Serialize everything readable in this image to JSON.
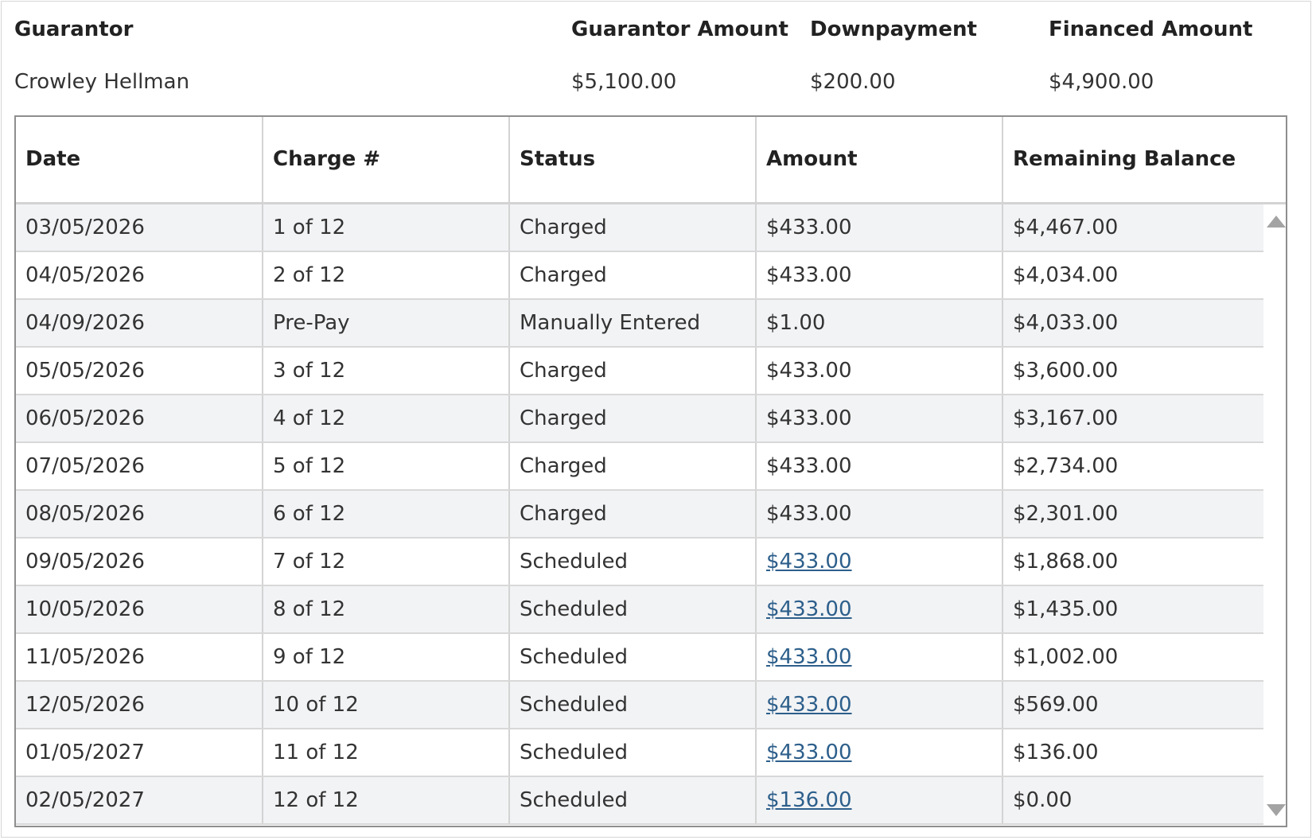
{
  "summary": {
    "headers": [
      "Guarantor",
      "Guarantor Amount",
      "Downpayment",
      "Financed Amount"
    ],
    "guarantor": "Crowley Hellman",
    "guarantor_amount": "$5,100.00",
    "downpayment": "$200.00",
    "financed_amount": "$4,900.00"
  },
  "table": {
    "columns": [
      "Date",
      "Charge #",
      "Status",
      "Amount",
      "Remaining Balance"
    ],
    "link_color": "#2d5f8b",
    "rows": [
      {
        "date": "03/05/2026",
        "charge": "1 of 12",
        "status": "Charged",
        "amount": "$433.00",
        "balance": "$4,467.00",
        "amount_link": false
      },
      {
        "date": "04/05/2026",
        "charge": "2 of 12",
        "status": "Charged",
        "amount": "$433.00",
        "balance": "$4,034.00",
        "amount_link": false
      },
      {
        "date": "04/09/2026",
        "charge": "Pre-Pay",
        "status": "Manually Entered",
        "amount": "$1.00",
        "balance": "$4,033.00",
        "amount_link": false
      },
      {
        "date": "05/05/2026",
        "charge": "3 of 12",
        "status": "Charged",
        "amount": "$433.00",
        "balance": "$3,600.00",
        "amount_link": false
      },
      {
        "date": "06/05/2026",
        "charge": "4 of 12",
        "status": "Charged",
        "amount": "$433.00",
        "balance": "$3,167.00",
        "amount_link": false
      },
      {
        "date": "07/05/2026",
        "charge": "5 of 12",
        "status": "Charged",
        "amount": "$433.00",
        "balance": "$2,734.00",
        "amount_link": false
      },
      {
        "date": "08/05/2026",
        "charge": "6 of 12",
        "status": "Charged",
        "amount": "$433.00",
        "balance": "$2,301.00",
        "amount_link": false
      },
      {
        "date": "09/05/2026",
        "charge": "7 of 12",
        "status": "Scheduled",
        "amount": "$433.00",
        "balance": "$1,868.00",
        "amount_link": true
      },
      {
        "date": "10/05/2026",
        "charge": "8 of 12",
        "status": "Scheduled",
        "amount": "$433.00",
        "balance": "$1,435.00",
        "amount_link": true
      },
      {
        "date": "11/05/2026",
        "charge": "9 of 12",
        "status": "Scheduled",
        "amount": "$433.00",
        "balance": "$1,002.00",
        "amount_link": true
      },
      {
        "date": "12/05/2026",
        "charge": "10 of 12",
        "status": "Scheduled",
        "amount": "$433.00",
        "balance": "$569.00",
        "amount_link": true
      },
      {
        "date": "01/05/2027",
        "charge": "11 of 12",
        "status": "Scheduled",
        "amount": "$433.00",
        "balance": "$136.00",
        "amount_link": true
      },
      {
        "date": "02/05/2027",
        "charge": "12 of 12",
        "status": "Scheduled",
        "amount": "$136.00",
        "balance": "$0.00",
        "amount_link": true
      }
    ]
  },
  "scrollbar": {
    "up_icon": "triangle-up",
    "down_icon": "triangle-down"
  }
}
